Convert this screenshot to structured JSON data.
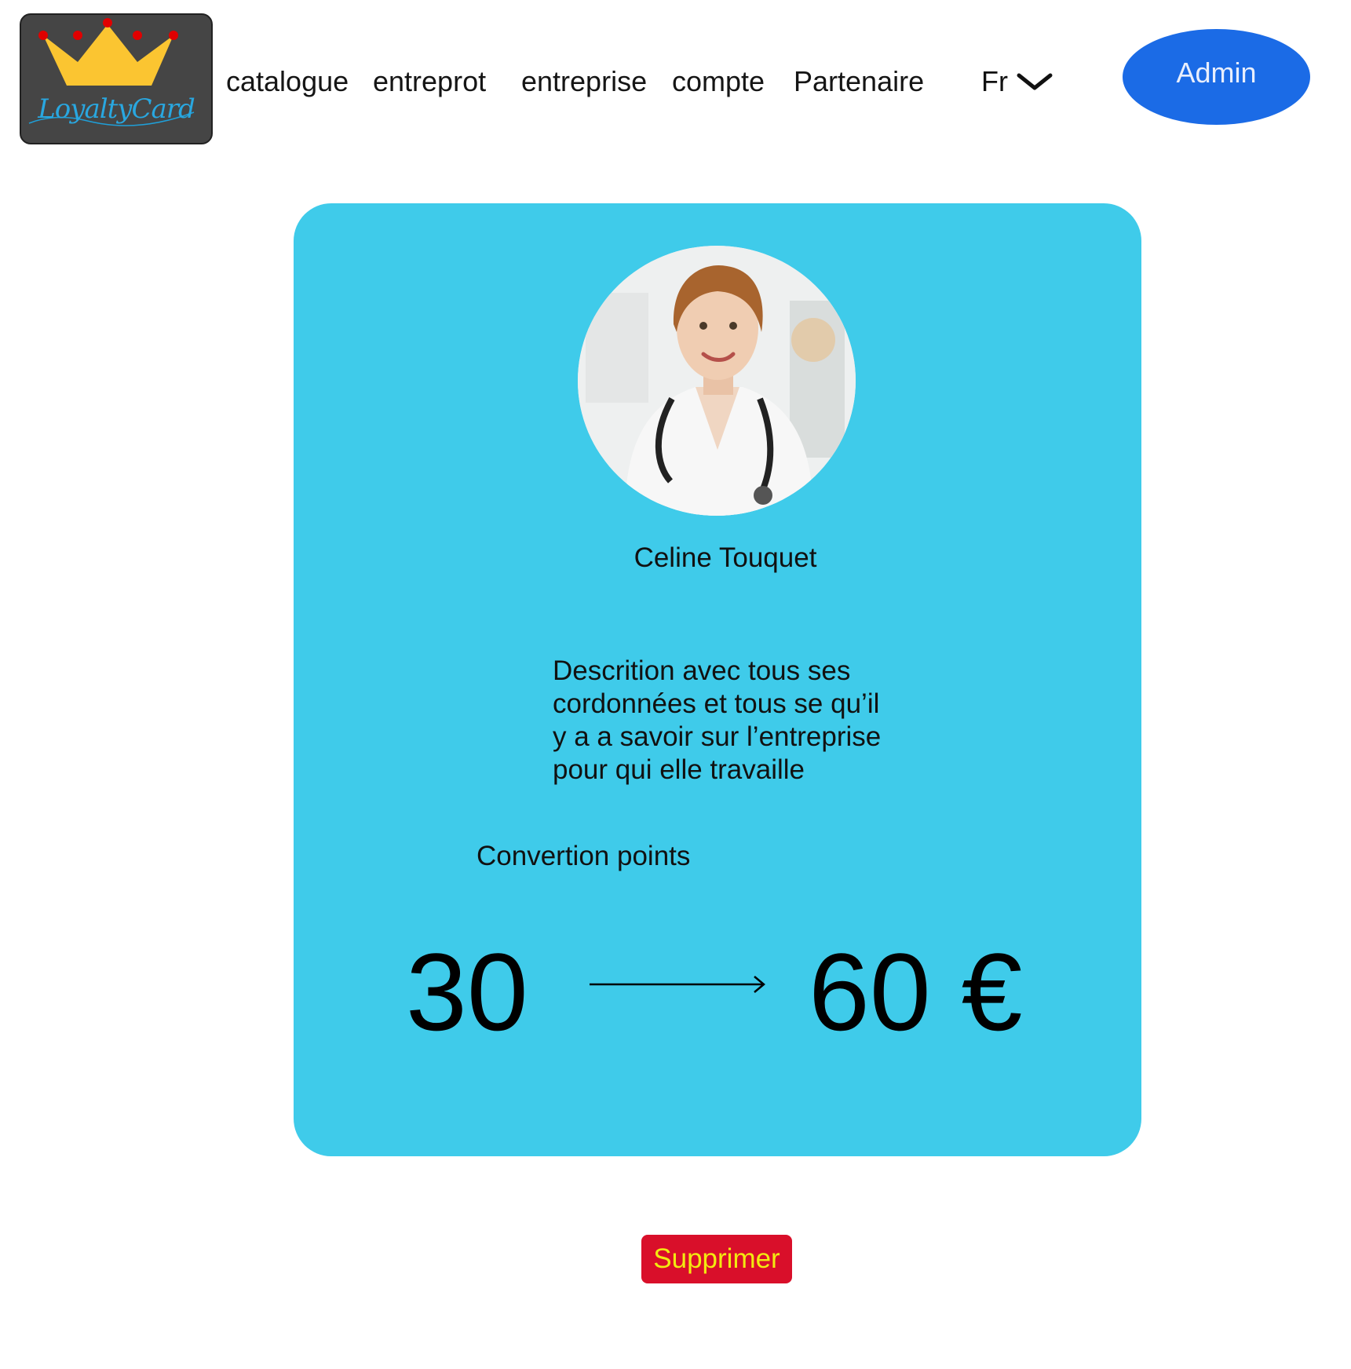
{
  "header": {
    "logo_text": "LoyaltyCard",
    "nav": [
      {
        "label": "catalogue"
      },
      {
        "label": "entreprot"
      },
      {
        "label": "entreprise"
      },
      {
        "label": "compte"
      },
      {
        "label": "Partenaire"
      }
    ],
    "language": {
      "selected": "Fr",
      "icon": "chevron-down-icon"
    },
    "admin_label": "Admin"
  },
  "profile": {
    "name": "Celine Touquet",
    "description_lines": [
      "Descrition avec tous ses",
      "cordonnées et tous se qu’il",
      "y a a savoir sur l’entreprise",
      "pour qui elle travaille"
    ],
    "conversion": {
      "label": "Convertion points",
      "points": "30",
      "arrow_icon": "arrow-right-icon",
      "value": "60 €"
    }
  },
  "actions": {
    "delete_label": "Supprimer"
  },
  "colors": {
    "card": "#3fcbea",
    "admin_button": "#1b6be6",
    "delete_button": "#d90f2a",
    "delete_text": "#f2ea10",
    "logo_bg": "#454545"
  }
}
